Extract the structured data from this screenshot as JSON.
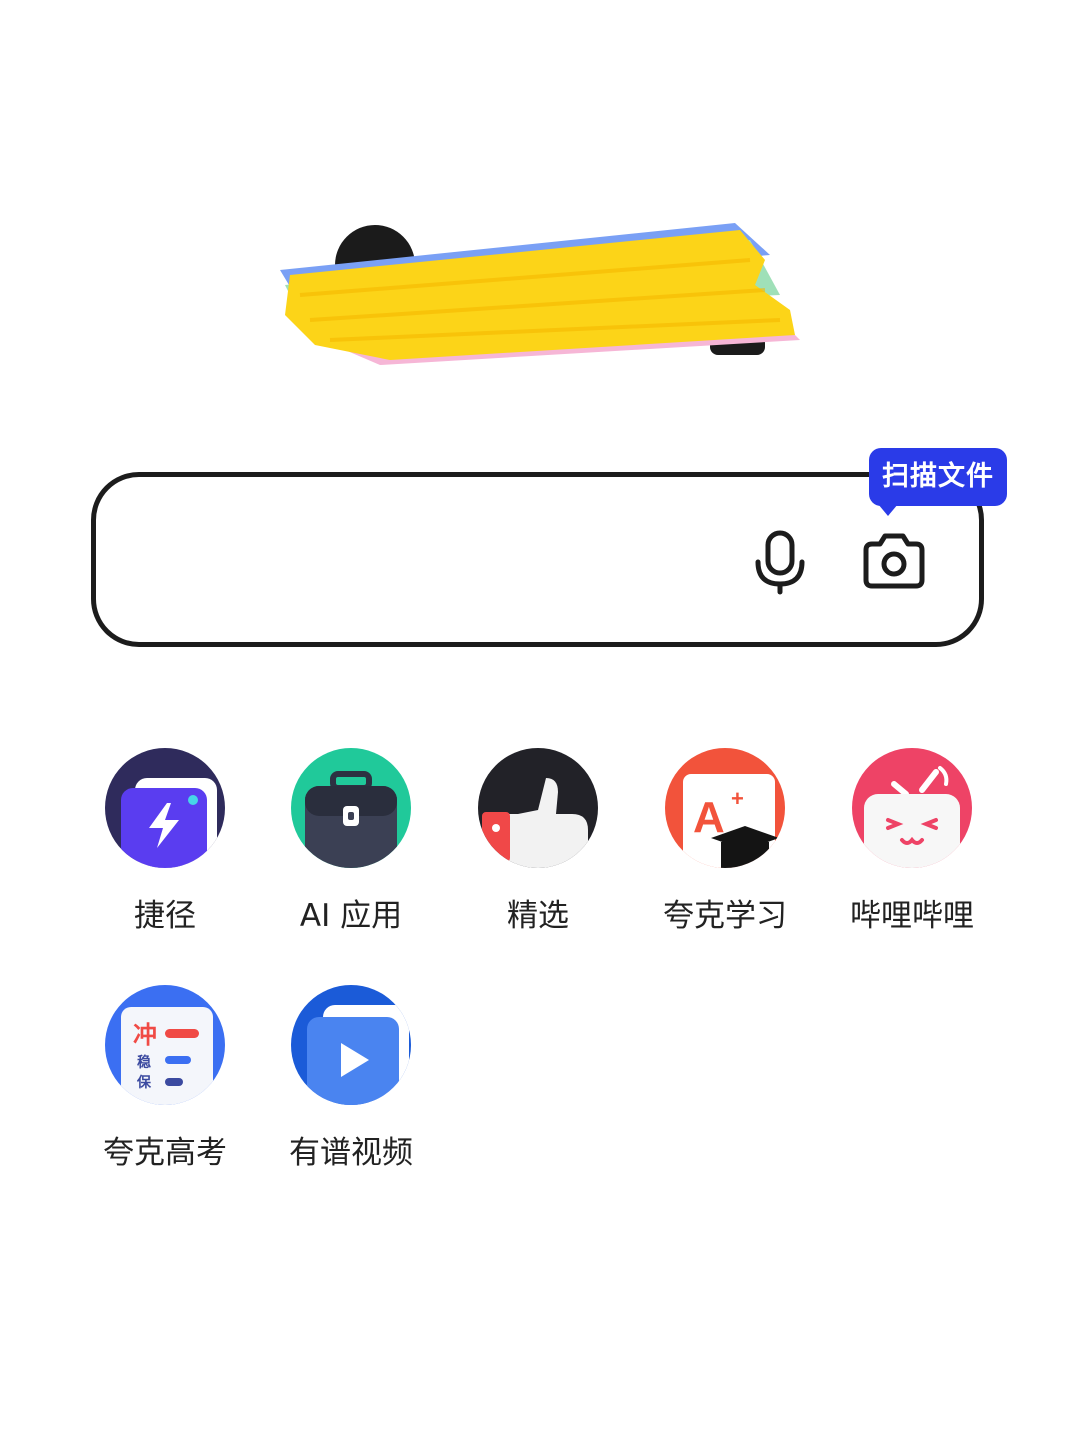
{
  "tooltip": {
    "text": "扫描文件"
  },
  "search": {
    "placeholder": ""
  },
  "apps": [
    {
      "label": "捷径",
      "icon": "shortcut-icon"
    },
    {
      "label": "AI 应用",
      "icon": "ai-toolbox-icon"
    },
    {
      "label": "精选",
      "icon": "thumbs-up-icon"
    },
    {
      "label": "夸克学习",
      "icon": "study-icon"
    },
    {
      "label": "哔哩哔哩",
      "icon": "bilibili-icon"
    },
    {
      "label": "夸克高考",
      "icon": "gaokao-icon"
    },
    {
      "label": "有谱视频",
      "icon": "video-play-icon"
    }
  ],
  "colors": {
    "accent": "#2a3be8",
    "logo_scribble": "#fcd418"
  }
}
